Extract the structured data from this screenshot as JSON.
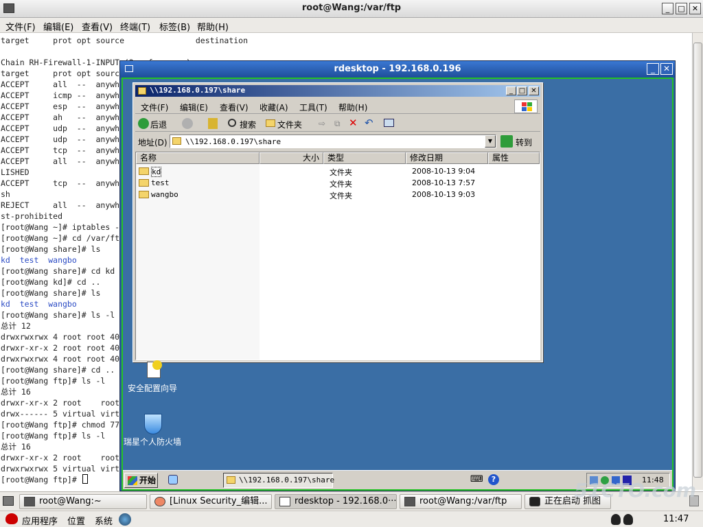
{
  "terminal_window": {
    "title": "root@Wang:/var/ftp",
    "menu": [
      "文件(F)",
      "编辑(E)",
      "查看(V)",
      "终端(T)",
      "标签(B)",
      "帮助(H)"
    ],
    "lines": [
      {
        "t": "target     prot opt source               destination"
      },
      {
        "t": ""
      },
      {
        "t": "Chain RH-Firewall-1-INPUT (2 references)"
      },
      {
        "t": "target     prot opt source"
      },
      {
        "t": "ACCEPT     all  --  anywh"
      },
      {
        "t": "ACCEPT     icmp --  anywh"
      },
      {
        "t": "ACCEPT     esp  --  anywh"
      },
      {
        "t": "ACCEPT     ah   --  anywh"
      },
      {
        "t": "ACCEPT     udp  --  anywh"
      },
      {
        "t": "ACCEPT     udp  --  anywh"
      },
      {
        "t": "ACCEPT     tcp  --  anywh"
      },
      {
        "t": "ACCEPT     all  --  anywh"
      },
      {
        "t": "LISHED"
      },
      {
        "t": "ACCEPT     tcp  --  anywh"
      },
      {
        "t": "sh"
      },
      {
        "t": "REJECT     all  --  anywh"
      },
      {
        "t": "st-prohibited"
      },
      {
        "t": "[root@Wang ~]# iptables -"
      },
      {
        "t": "[root@Wang ~]# cd /var/ft"
      },
      {
        "t": "[root@Wang share]# ls"
      },
      {
        "t": "kd  test  wangbo",
        "c": "blue"
      },
      {
        "t": "[root@Wang share]# cd kd"
      },
      {
        "t": "[root@Wang kd]# cd .."
      },
      {
        "t": "[root@Wang share]# ls"
      },
      {
        "t": "kd  test  wangbo",
        "c": "blue"
      },
      {
        "t": "[root@Wang share]# ls -l"
      },
      {
        "t": "总计 12"
      },
      {
        "t": "drwxrwxrwx 4 root root 40"
      },
      {
        "t": "drwxr-xr-x 2 root root 40"
      },
      {
        "t": "drwxrwxrwx 4 root root 40"
      },
      {
        "t": "[root@Wang share]# cd .."
      },
      {
        "t": "[root@Wang ftp]# ls -l"
      },
      {
        "t": "总计 16"
      },
      {
        "t": "drwxr-xr-x 2 root    root"
      },
      {
        "t": "drwx------ 5 virtual virt"
      },
      {
        "t": "[root@Wang ftp]# chmod 77"
      },
      {
        "t": "[root@Wang ftp]# ls -l"
      },
      {
        "t": "总计 16"
      },
      {
        "t": "drwxr-xr-x 2 root    root"
      },
      {
        "t": "drwxrwxrwx 5 virtual virt"
      },
      {
        "t": "[root@Wang ftp]# "
      }
    ]
  },
  "rdesktop": {
    "title": "rdesktop - 192.168.0.196"
  },
  "explorer": {
    "title": "\\\\192.168.0.197\\share",
    "menu": [
      "文件(F)",
      "编辑(E)",
      "查看(V)",
      "收藏(A)",
      "工具(T)",
      "帮助(H)"
    ],
    "toolbar": {
      "back": "后退",
      "search": "搜索",
      "folders": "文件夹"
    },
    "address_label": "地址(D)",
    "address": "\\\\192.168.0.197\\share",
    "go": "转到",
    "columns": [
      "名称",
      "大小",
      "类型",
      "修改日期",
      "属性"
    ],
    "rows": [
      {
        "name": "kd",
        "type": "文件夹",
        "date": "2008-10-13 9:04"
      },
      {
        "name": "test",
        "type": "文件夹",
        "date": "2008-10-13 7:57"
      },
      {
        "name": "wangbo",
        "type": "文件夹",
        "date": "2008-10-13 9:03"
      }
    ]
  },
  "desktop_icons": [
    "安全配置向导",
    "瑞星个人防火墙"
  ],
  "xp_taskbar": {
    "start": "开始",
    "task": "\\\\192.168.0.197\\share",
    "clock": "11:48"
  },
  "gnome_taskbar": [
    "root@Wang:~",
    "[Linux Security_编辑...",
    "rdesktop - 192.168.0···",
    "root@Wang:/var/ftp",
    "正在启动 抓图"
  ],
  "gnome_panel": {
    "apps": "应用程序",
    "places": "位置",
    "system": "系统",
    "clock": "11:47"
  },
  "watermark": "51CTO.com"
}
